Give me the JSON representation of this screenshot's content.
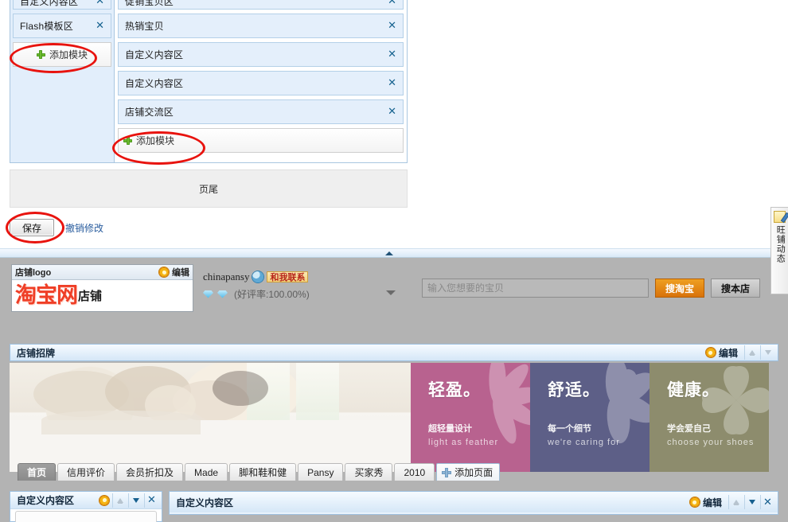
{
  "editor": {
    "left_column": {
      "modules": [
        {
          "label": "自定义内容区",
          "close": "✕"
        },
        {
          "label": "Flash模板区",
          "close": "✕"
        }
      ],
      "add_module_label": "添加模块"
    },
    "right_column": {
      "modules": [
        {
          "label": "促销宝贝区",
          "close": "✕"
        },
        {
          "label": "热销宝贝",
          "close": "✕"
        },
        {
          "label": "自定义内容区",
          "close": "✕"
        },
        {
          "label": "自定义内容区",
          "close": "✕"
        },
        {
          "label": "店铺交流区",
          "close": "✕"
        }
      ],
      "add_module_label": "添加模块"
    },
    "footer_label": "页尾",
    "save_label": "保存",
    "undo_label": "撤销修改",
    "annotation_color": "#e8130e"
  },
  "preview": {
    "logo_panel": {
      "bar_label": "店铺logo",
      "edit_label": "编辑",
      "brand_text": "淘宝网",
      "brand_suffix": "店铺"
    },
    "seller": {
      "nick": "chinapansy",
      "contact_badge": "和我联系",
      "rating": "(好评率:100.00%)",
      "diamond_count": 2
    },
    "search": {
      "placeholder": "输入您想要的宝贝",
      "value": "",
      "search_taobao_label": "搜淘宝",
      "search_shop_label": "搜本店",
      "accent_color": "#d8720a"
    },
    "banner_module": {
      "title": "店铺招牌",
      "edit_label": "编辑"
    },
    "banner_cards": [
      {
        "heading": "轻盈。",
        "sub_cn": "超轻量设计",
        "sub_en": "light as feather",
        "color": "#b8628f"
      },
      {
        "heading": "舒适。",
        "sub_cn": "每一个细节",
        "sub_en": "we're caring for",
        "color": "#5d5f87"
      },
      {
        "heading": "健康。",
        "sub_cn": "学会爱自己",
        "sub_en": "choose your shoes",
        "color": "#8d8c6d"
      }
    ],
    "tabs": [
      {
        "label": "首页",
        "active": true
      },
      {
        "label": "信用评价",
        "active": false
      },
      {
        "label": "会员折扣及",
        "active": false
      },
      {
        "label": "Made",
        "active": false
      },
      {
        "label": "脚和鞋和健",
        "active": false
      },
      {
        "label": "Pansy",
        "active": false
      },
      {
        "label": "买家秀",
        "active": false
      },
      {
        "label": "2010",
        "active": false
      }
    ],
    "add_page_label": "添加页面",
    "bottom_modules": {
      "left_title": "自定义内容区",
      "right_title": "自定义内容区",
      "edit_label": "编辑"
    },
    "side_tab": {
      "text": "旺铺动态"
    }
  }
}
